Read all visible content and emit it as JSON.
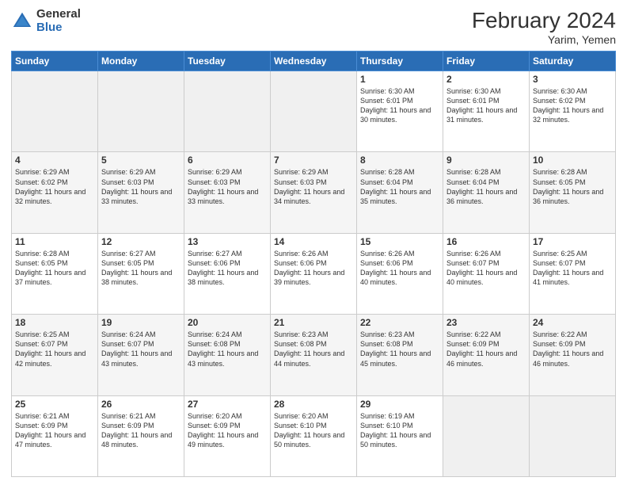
{
  "header": {
    "logo_general": "General",
    "logo_blue": "Blue",
    "title": "February 2024",
    "location": "Yarim, Yemen"
  },
  "days_of_week": [
    "Sunday",
    "Monday",
    "Tuesday",
    "Wednesday",
    "Thursday",
    "Friday",
    "Saturday"
  ],
  "weeks": [
    [
      {
        "day": "",
        "info": "",
        "empty": true
      },
      {
        "day": "",
        "info": "",
        "empty": true
      },
      {
        "day": "",
        "info": "",
        "empty": true
      },
      {
        "day": "",
        "info": "",
        "empty": true
      },
      {
        "day": "1",
        "info": "Sunrise: 6:30 AM\nSunset: 6:01 PM\nDaylight: 11 hours\nand 30 minutes.",
        "empty": false
      },
      {
        "day": "2",
        "info": "Sunrise: 6:30 AM\nSunset: 6:01 PM\nDaylight: 11 hours\nand 31 minutes.",
        "empty": false
      },
      {
        "day": "3",
        "info": "Sunrise: 6:30 AM\nSunset: 6:02 PM\nDaylight: 11 hours\nand 32 minutes.",
        "empty": false
      }
    ],
    [
      {
        "day": "4",
        "info": "Sunrise: 6:29 AM\nSunset: 6:02 PM\nDaylight: 11 hours\nand 32 minutes.",
        "empty": false
      },
      {
        "day": "5",
        "info": "Sunrise: 6:29 AM\nSunset: 6:03 PM\nDaylight: 11 hours\nand 33 minutes.",
        "empty": false
      },
      {
        "day": "6",
        "info": "Sunrise: 6:29 AM\nSunset: 6:03 PM\nDaylight: 11 hours\nand 33 minutes.",
        "empty": false
      },
      {
        "day": "7",
        "info": "Sunrise: 6:29 AM\nSunset: 6:03 PM\nDaylight: 11 hours\nand 34 minutes.",
        "empty": false
      },
      {
        "day": "8",
        "info": "Sunrise: 6:28 AM\nSunset: 6:04 PM\nDaylight: 11 hours\nand 35 minutes.",
        "empty": false
      },
      {
        "day": "9",
        "info": "Sunrise: 6:28 AM\nSunset: 6:04 PM\nDaylight: 11 hours\nand 36 minutes.",
        "empty": false
      },
      {
        "day": "10",
        "info": "Sunrise: 6:28 AM\nSunset: 6:05 PM\nDaylight: 11 hours\nand 36 minutes.",
        "empty": false
      }
    ],
    [
      {
        "day": "11",
        "info": "Sunrise: 6:28 AM\nSunset: 6:05 PM\nDaylight: 11 hours\nand 37 minutes.",
        "empty": false
      },
      {
        "day": "12",
        "info": "Sunrise: 6:27 AM\nSunset: 6:05 PM\nDaylight: 11 hours\nand 38 minutes.",
        "empty": false
      },
      {
        "day": "13",
        "info": "Sunrise: 6:27 AM\nSunset: 6:06 PM\nDaylight: 11 hours\nand 38 minutes.",
        "empty": false
      },
      {
        "day": "14",
        "info": "Sunrise: 6:26 AM\nSunset: 6:06 PM\nDaylight: 11 hours\nand 39 minutes.",
        "empty": false
      },
      {
        "day": "15",
        "info": "Sunrise: 6:26 AM\nSunset: 6:06 PM\nDaylight: 11 hours\nand 40 minutes.",
        "empty": false
      },
      {
        "day": "16",
        "info": "Sunrise: 6:26 AM\nSunset: 6:07 PM\nDaylight: 11 hours\nand 40 minutes.",
        "empty": false
      },
      {
        "day": "17",
        "info": "Sunrise: 6:25 AM\nSunset: 6:07 PM\nDaylight: 11 hours\nand 41 minutes.",
        "empty": false
      }
    ],
    [
      {
        "day": "18",
        "info": "Sunrise: 6:25 AM\nSunset: 6:07 PM\nDaylight: 11 hours\nand 42 minutes.",
        "empty": false
      },
      {
        "day": "19",
        "info": "Sunrise: 6:24 AM\nSunset: 6:07 PM\nDaylight: 11 hours\nand 43 minutes.",
        "empty": false
      },
      {
        "day": "20",
        "info": "Sunrise: 6:24 AM\nSunset: 6:08 PM\nDaylight: 11 hours\nand 43 minutes.",
        "empty": false
      },
      {
        "day": "21",
        "info": "Sunrise: 6:23 AM\nSunset: 6:08 PM\nDaylight: 11 hours\nand 44 minutes.",
        "empty": false
      },
      {
        "day": "22",
        "info": "Sunrise: 6:23 AM\nSunset: 6:08 PM\nDaylight: 11 hours\nand 45 minutes.",
        "empty": false
      },
      {
        "day": "23",
        "info": "Sunrise: 6:22 AM\nSunset: 6:09 PM\nDaylight: 11 hours\nand 46 minutes.",
        "empty": false
      },
      {
        "day": "24",
        "info": "Sunrise: 6:22 AM\nSunset: 6:09 PM\nDaylight: 11 hours\nand 46 minutes.",
        "empty": false
      }
    ],
    [
      {
        "day": "25",
        "info": "Sunrise: 6:21 AM\nSunset: 6:09 PM\nDaylight: 11 hours\nand 47 minutes.",
        "empty": false
      },
      {
        "day": "26",
        "info": "Sunrise: 6:21 AM\nSunset: 6:09 PM\nDaylight: 11 hours\nand 48 minutes.",
        "empty": false
      },
      {
        "day": "27",
        "info": "Sunrise: 6:20 AM\nSunset: 6:09 PM\nDaylight: 11 hours\nand 49 minutes.",
        "empty": false
      },
      {
        "day": "28",
        "info": "Sunrise: 6:20 AM\nSunset: 6:10 PM\nDaylight: 11 hours\nand 50 minutes.",
        "empty": false
      },
      {
        "day": "29",
        "info": "Sunrise: 6:19 AM\nSunset: 6:10 PM\nDaylight: 11 hours\nand 50 minutes.",
        "empty": false
      },
      {
        "day": "",
        "info": "",
        "empty": true
      },
      {
        "day": "",
        "info": "",
        "empty": true
      }
    ]
  ]
}
